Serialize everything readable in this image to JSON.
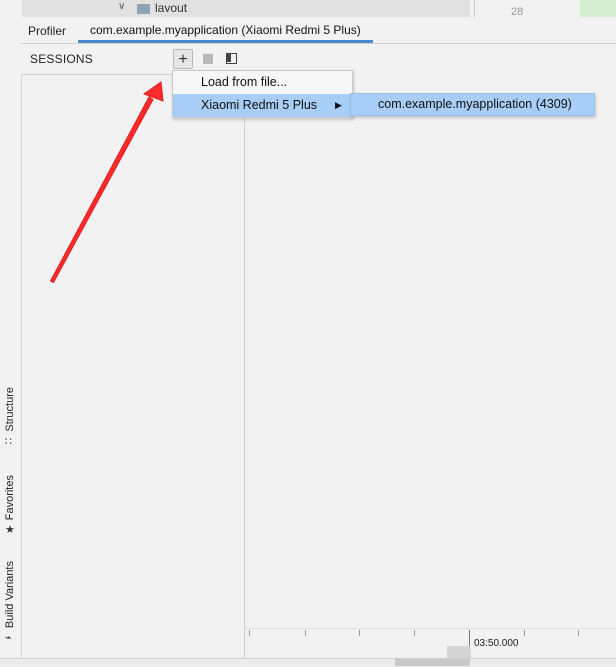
{
  "project_tree": {
    "row_label": "layout",
    "line_number": "28"
  },
  "left_strip": {
    "tools": [
      {
        "label": "Structure",
        "icon": "structure-icon"
      },
      {
        "label": "Favorites",
        "icon": "star-icon"
      },
      {
        "label": "Build Variants",
        "icon": "build-variants-icon"
      }
    ]
  },
  "tabs": {
    "profiler": "Profiler",
    "session": "com.example.myapplication (Xiaomi Redmi 5 Plus)"
  },
  "sessions": {
    "title": "SESSIONS",
    "add_label": "+"
  },
  "menu": {
    "load_from_file": "Load from file...",
    "device": "Xiaomi Redmi 5 Plus",
    "submenu_app": "com.example.myapplication (4309)"
  },
  "timeline": {
    "time_label": "03:50.000"
  },
  "colors": {
    "selection": "#a8cdf7",
    "tab_underline": "#4a87c8",
    "annotation_arrow": "#ff2a2a"
  }
}
